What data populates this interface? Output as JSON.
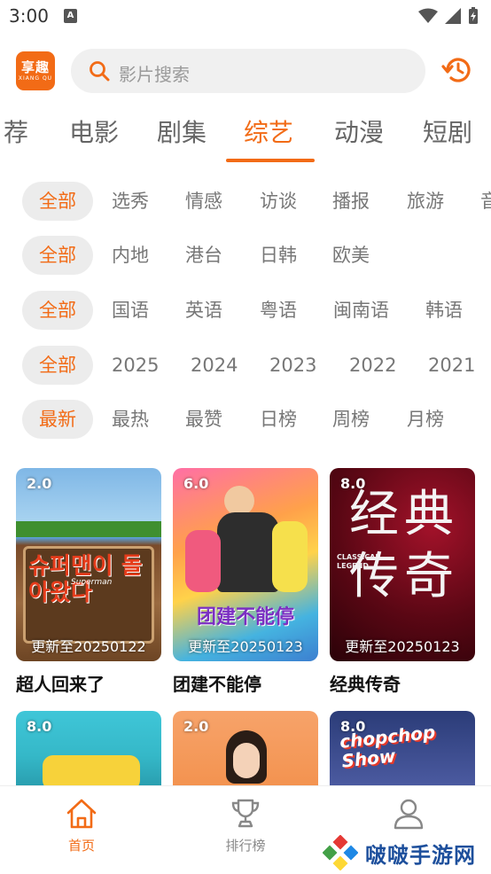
{
  "status_bar": {
    "time": "3:00",
    "notif_letter": "A"
  },
  "header": {
    "logo_main": "享趣",
    "logo_sub": "XIANG QU",
    "search_placeholder": "影片搜索"
  },
  "tabs": [
    {
      "label": "荐"
    },
    {
      "label": "电影"
    },
    {
      "label": "剧集"
    },
    {
      "label": "综艺"
    },
    {
      "label": "动漫"
    },
    {
      "label": "短剧"
    }
  ],
  "active_tab": "综艺",
  "filters": [
    {
      "chips": [
        "全部",
        "选秀",
        "情感",
        "访谈",
        "播报",
        "旅游",
        "音"
      ]
    },
    {
      "chips": [
        "全部",
        "内地",
        "港台",
        "日韩",
        "欧美"
      ]
    },
    {
      "chips": [
        "全部",
        "国语",
        "英语",
        "粤语",
        "闽南语",
        "韩语"
      ]
    },
    {
      "chips": [
        "全部",
        "2025",
        "2024",
        "2023",
        "2022",
        "2021"
      ]
    },
    {
      "chips": [
        "最新",
        "最热",
        "最赞",
        "日榜",
        "周榜",
        "月榜"
      ]
    }
  ],
  "cards": [
    {
      "score": "2.0",
      "update": "更新至20250122",
      "title": "超人回来了",
      "poster_text": "슈퍼맨이 돌아왔다",
      "poster_sub": "Superman"
    },
    {
      "score": "6.0",
      "update": "更新至20250123",
      "title": "团建不能停",
      "poster_text": "团建不能停",
      "poster_sub": ""
    },
    {
      "score": "8.0",
      "update": "更新至20250123",
      "title": "经典传奇",
      "poster_text": "经典 传奇",
      "poster_sub": "CLASSICAL LEGEND"
    },
    {
      "score": "8.0",
      "update": "",
      "title": "",
      "poster_text": "",
      "poster_sub": ""
    },
    {
      "score": "2.0",
      "update": "",
      "title": "",
      "poster_text": "",
      "poster_sub": ""
    },
    {
      "score": "8.0",
      "update": "",
      "title": "",
      "poster_text": "chopchop Show",
      "poster_sub": ""
    }
  ],
  "bottom_nav": [
    {
      "label": "首页",
      "icon": "home-icon",
      "active": true
    },
    {
      "label": "排行榜",
      "icon": "trophy-icon",
      "active": false
    },
    {
      "label": "",
      "icon": "user-icon",
      "active": false
    }
  ],
  "watermark": "啵啵手游网",
  "colors": {
    "accent": "#f26b16",
    "chip_bg": "#ececec",
    "search_bg": "#f0f0f0"
  }
}
